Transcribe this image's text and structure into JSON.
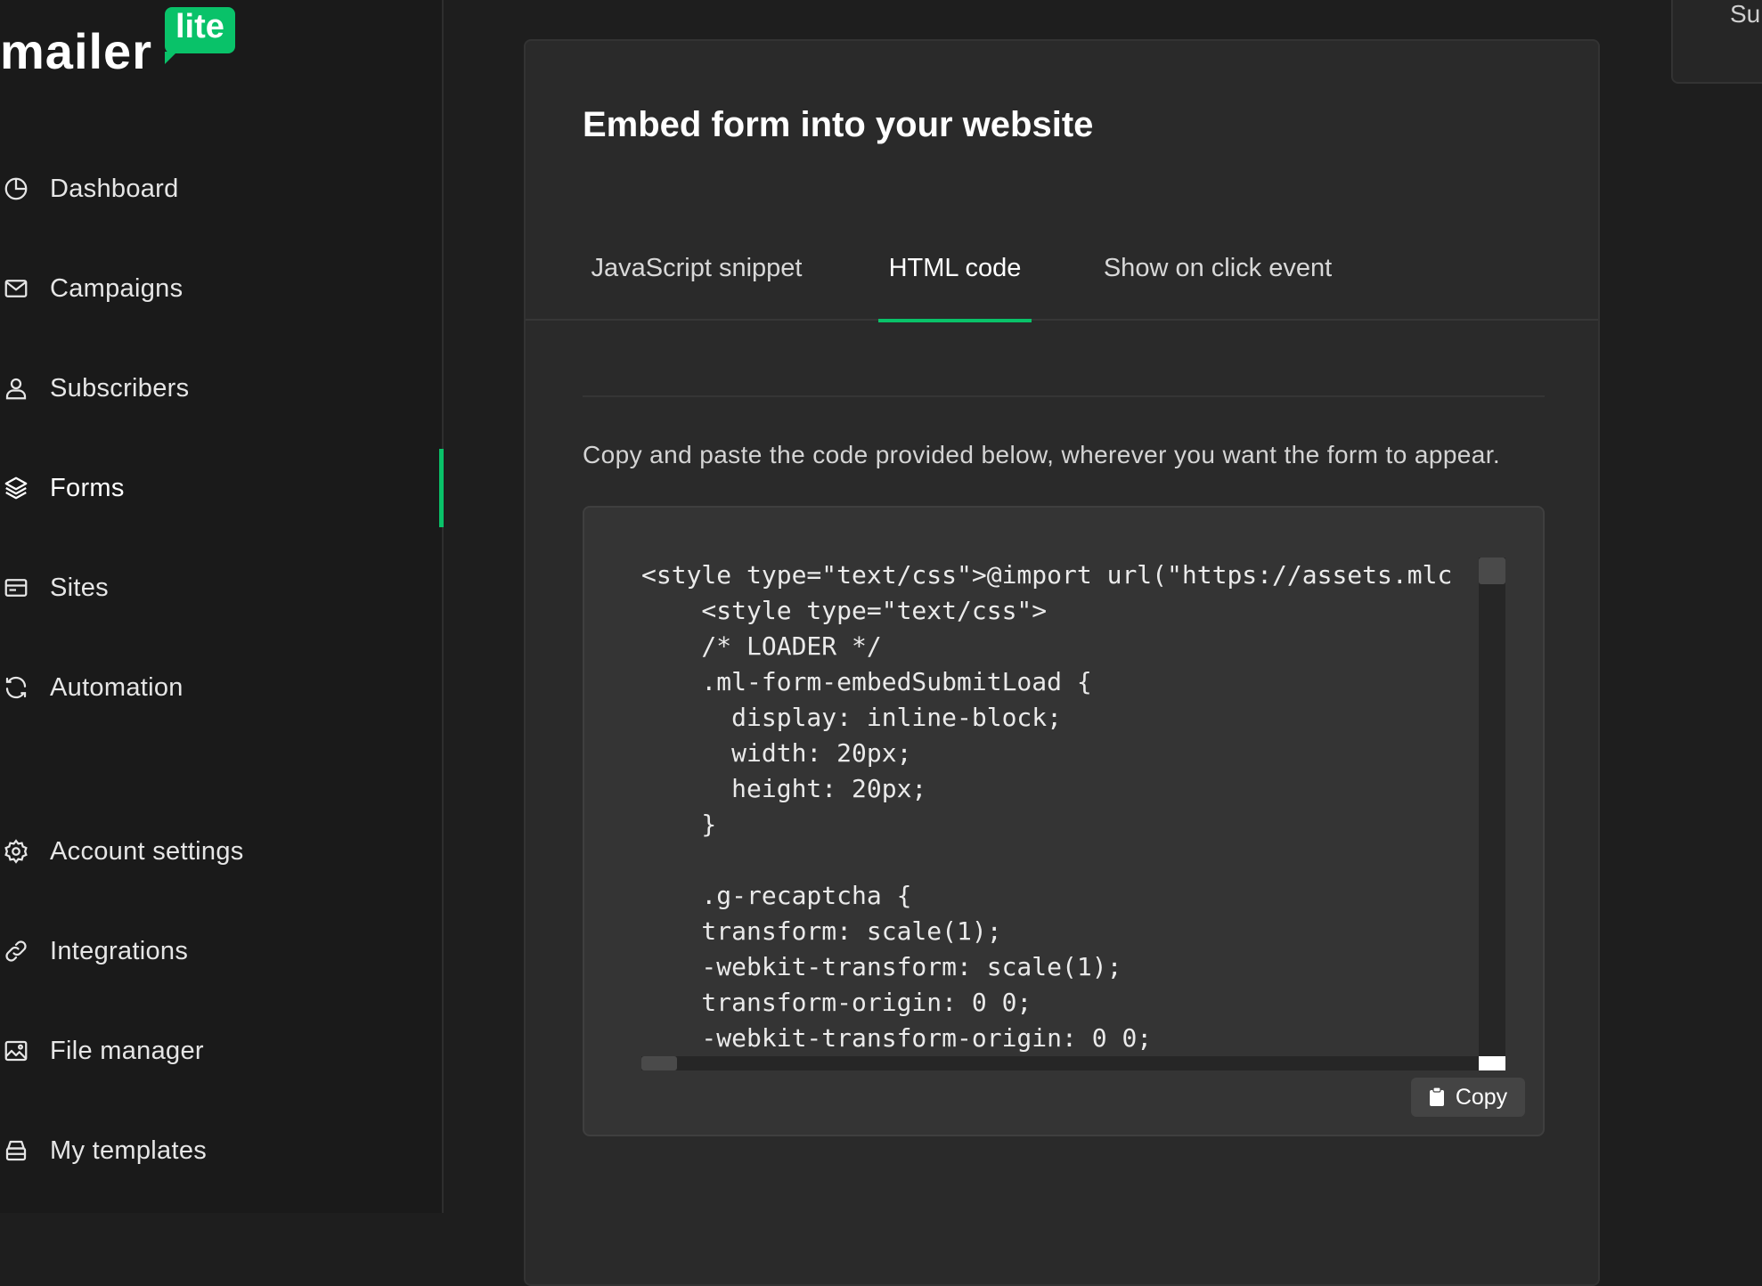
{
  "brand": {
    "name": "mailer",
    "badge": "lite",
    "accent_color": "#09c269"
  },
  "sidebar": {
    "items": [
      {
        "label": "Dashboard",
        "icon": "dashboard-icon",
        "active": false
      },
      {
        "label": "Campaigns",
        "icon": "mail-icon",
        "active": false
      },
      {
        "label": "Subscribers",
        "icon": "user-icon",
        "active": false
      },
      {
        "label": "Forms",
        "icon": "layers-icon",
        "active": true
      },
      {
        "label": "Sites",
        "icon": "browser-icon",
        "active": false
      },
      {
        "label": "Automation",
        "icon": "refresh-icon",
        "active": false
      },
      {
        "label": "Account settings",
        "icon": "gear-icon",
        "active": false
      },
      {
        "label": "Integrations",
        "icon": "link-icon",
        "active": false
      },
      {
        "label": "File manager",
        "icon": "image-icon",
        "active": false
      },
      {
        "label": "My templates",
        "icon": "stack-icon",
        "active": false
      }
    ]
  },
  "main": {
    "title": "Embed form into your website",
    "tabs": [
      {
        "label": "JavaScript snippet",
        "active": false
      },
      {
        "label": "HTML code",
        "active": true
      },
      {
        "label": "Show on click event",
        "active": false
      }
    ],
    "description": "Copy and paste the code provided below, wherever you want the form to appear.",
    "code_lines": [
      "<style type=\"text/css\">@import url(\"https://assets.mlc",
      "    <style type=\"text/css\">",
      "    /* LOADER */",
      "    .ml-form-embedSubmitLoad {",
      "      display: inline-block;",
      "      width: 20px;",
      "      height: 20px;",
      "    }",
      "",
      "    .g-recaptcha {",
      "    transform: scale(1);",
      "    -webkit-transform: scale(1);",
      "    transform-origin: 0 0;",
      "    -webkit-transform-origin: 0 0;"
    ],
    "copy_label": "Copy"
  },
  "side_card": {
    "text": "Su"
  }
}
